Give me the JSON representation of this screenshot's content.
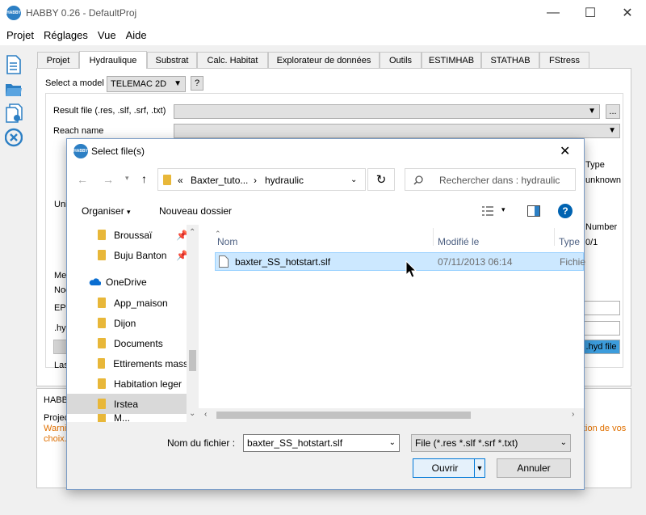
{
  "window": {
    "title": "HABBY 0.26 - DefaultProj",
    "logo_text": "HABBY"
  },
  "menu": [
    "Projet",
    "Réglages",
    "Vue",
    "Aide"
  ],
  "tabs": [
    "Projet",
    "Hydraulique",
    "Substrat",
    "Calc. Habitat",
    "Explorateur de données",
    "Outils",
    "ESTIMHAB",
    "STATHAB",
    "FStress"
  ],
  "hydraulic": {
    "select_model_label": "Select a model",
    "model_value": "TELEMAC 2D",
    "help_label": "?",
    "result_file_label": "Result file (.res, .slf, .srf, .txt)",
    "browse_label": "...",
    "reach_name_label": "Reach name",
    "type_label": "Type",
    "type_value": "unknown",
    "number_label": "Number",
    "number_value": "0/1",
    "unit_label": "Uni",
    "mes_label": "Mes",
    "noc_label": "Noc",
    "eps_label": "EPS",
    "hyd_label": ".hyd",
    "last_label": "Las",
    "hyd_button": ".hyd file"
  },
  "log": {
    "title": "HABBY",
    "project_label": "Projec",
    "warning_label": "Warni",
    "choice_label": "choix.",
    "warning_tail": "tion de vos"
  },
  "dialog": {
    "title": "Select file(s)",
    "path": [
      "«",
      "Baxter_tuto...",
      "hydraulic"
    ],
    "search_placeholder": "Rechercher dans : hydraulic",
    "organize_label": "Organiser",
    "new_folder_label": "Nouveau dossier",
    "nav_items": [
      "Broussaï",
      "Buju Banton",
      "OneDrive",
      "App_maison",
      "Dijon",
      "Documents",
      "Ettirements mass",
      "Habitation leger",
      "Irstea",
      "M..."
    ],
    "columns": {
      "name": "Nom",
      "modified": "Modifié le",
      "type": "Type"
    },
    "files": [
      {
        "name": "baxter_SS_hotstart.slf",
        "modified": "07/11/2013 06:14",
        "type": "Fichie"
      }
    ],
    "filename_label": "Nom du fichier :",
    "filename_value": "baxter_SS_hotstart.slf",
    "filter_value": "File (*.res *.slf *.srf *.txt)",
    "open_label": "Ouvrir",
    "cancel_label": "Annuler"
  },
  "colors": {
    "accent": "#0078d7",
    "selected": "#cce8ff",
    "warning": "#e07000",
    "icon_blue": "#2c7fc4"
  },
  "icons": [
    "new-project-icon",
    "open-project-icon",
    "save-project-icon",
    "close-project-icon",
    "refresh-icon",
    "search-icon",
    "view-list-icon",
    "help-icon",
    "onedrive-icon",
    "pin-icon",
    "file-icon",
    "cursor-icon"
  ]
}
